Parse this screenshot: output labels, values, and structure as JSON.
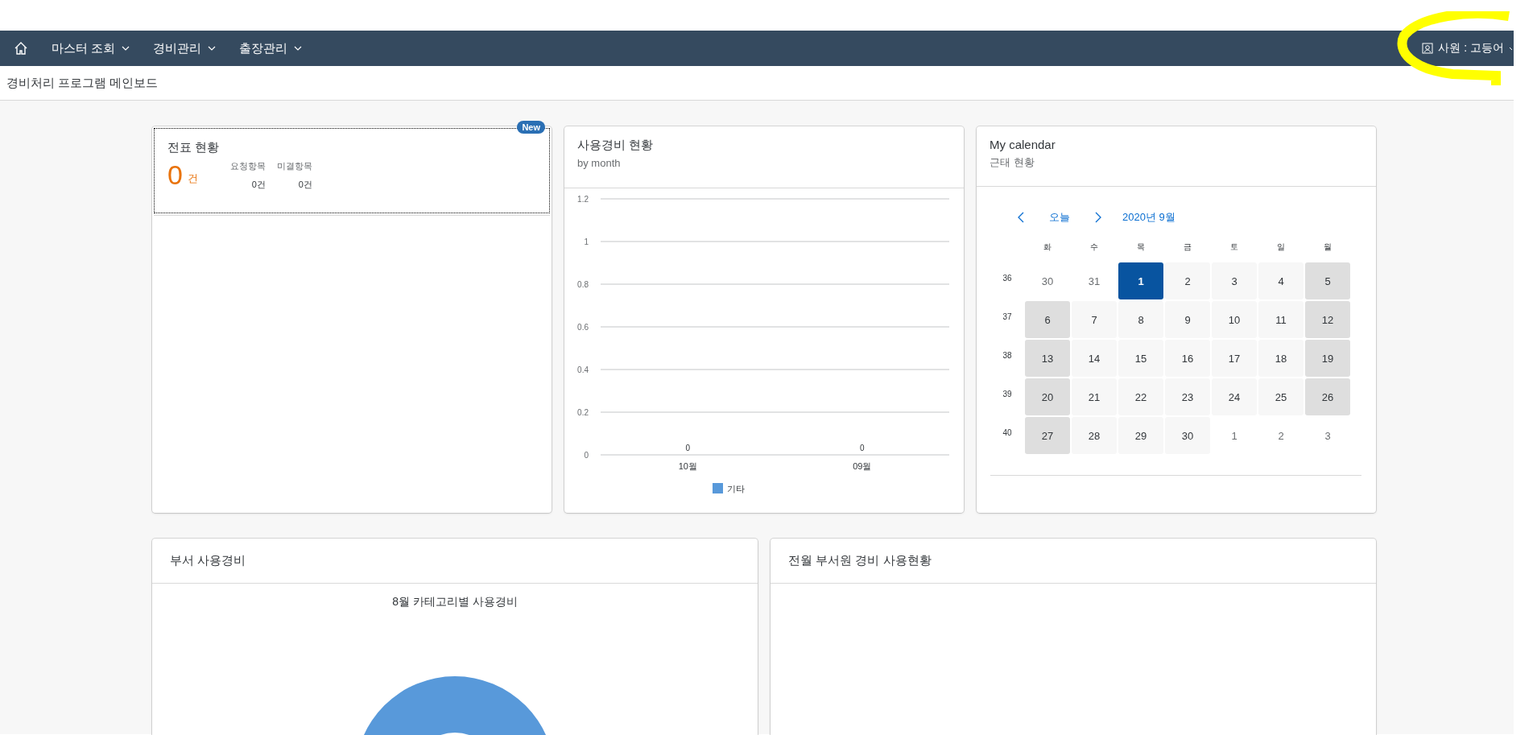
{
  "nav": {
    "items": [
      {
        "label": "마스터 조회"
      },
      {
        "label": "경비관리"
      },
      {
        "label": "출장관리"
      }
    ],
    "user": "사원 : 고등어"
  },
  "page_title": "경비처리 프로그램 메인보드",
  "voucher_card": {
    "title": "전표 현황",
    "badge": "New",
    "total": "0",
    "total_unit": "건",
    "stats": [
      {
        "label": "요청항목",
        "value": "0건"
      },
      {
        "label": "미결항목",
        "value": "0건"
      }
    ]
  },
  "expense_card": {
    "title": "사용경비 현황",
    "subtitle": "by month",
    "chart_data": {
      "type": "bar",
      "categories": [
        "10월",
        "09월"
      ],
      "series": [
        {
          "name": "기타",
          "color": "#5899da",
          "values": [
            0,
            0
          ]
        }
      ],
      "ylim": [
        0,
        1.2
      ],
      "yticks": [
        0,
        0.2,
        0.4,
        0.6,
        0.8,
        1,
        1.2
      ],
      "data_labels": true,
      "grid": true
    }
  },
  "calendar_card": {
    "title": "My calendar",
    "subtitle": "근태 현황",
    "today_button": "오늘",
    "month": "2020년 9월",
    "weekdays": [
      "화",
      "수",
      "목",
      "금",
      "토",
      "일",
      "월"
    ],
    "weeks": [
      {
        "number": "36",
        "days": [
          {
            "day": "30",
            "kind": "outside",
            "selected": false
          },
          {
            "day": "31",
            "kind": "outside",
            "selected": false
          },
          {
            "day": "1",
            "kind": "workday",
            "selected": true
          },
          {
            "day": "2",
            "kind": "workday",
            "selected": false
          },
          {
            "day": "3",
            "kind": "workday",
            "selected": false
          },
          {
            "day": "4",
            "kind": "workday",
            "selected": false
          },
          {
            "day": "5",
            "kind": "holiday",
            "selected": false
          }
        ]
      },
      {
        "number": "37",
        "days": [
          {
            "day": "6",
            "kind": "holiday",
            "selected": false
          },
          {
            "day": "7",
            "kind": "workday",
            "selected": false
          },
          {
            "day": "8",
            "kind": "workday",
            "selected": false
          },
          {
            "day": "9",
            "kind": "workday",
            "selected": false
          },
          {
            "day": "10",
            "kind": "workday",
            "selected": false
          },
          {
            "day": "11",
            "kind": "workday",
            "selected": false
          },
          {
            "day": "12",
            "kind": "holiday",
            "selected": false
          }
        ]
      },
      {
        "number": "38",
        "days": [
          {
            "day": "13",
            "kind": "holiday",
            "selected": false
          },
          {
            "day": "14",
            "kind": "workday",
            "selected": false
          },
          {
            "day": "15",
            "kind": "workday",
            "selected": false
          },
          {
            "day": "16",
            "kind": "workday",
            "selected": false
          },
          {
            "day": "17",
            "kind": "workday",
            "selected": false
          },
          {
            "day": "18",
            "kind": "workday",
            "selected": false
          },
          {
            "day": "19",
            "kind": "holiday",
            "selected": false
          }
        ]
      },
      {
        "number": "39",
        "days": [
          {
            "day": "20",
            "kind": "holiday",
            "selected": false
          },
          {
            "day": "21",
            "kind": "workday",
            "selected": false
          },
          {
            "day": "22",
            "kind": "workday",
            "selected": false
          },
          {
            "day": "23",
            "kind": "workday",
            "selected": false
          },
          {
            "day": "24",
            "kind": "workday",
            "selected": false
          },
          {
            "day": "25",
            "kind": "workday",
            "selected": false
          },
          {
            "day": "26",
            "kind": "holiday",
            "selected": false
          }
        ]
      },
      {
        "number": "40",
        "days": [
          {
            "day": "27",
            "kind": "holiday",
            "selected": false
          },
          {
            "day": "28",
            "kind": "workday",
            "selected": false
          },
          {
            "day": "29",
            "kind": "workday",
            "selected": false
          },
          {
            "day": "30",
            "kind": "workday",
            "selected": false
          },
          {
            "day": "1",
            "kind": "outside",
            "selected": false
          },
          {
            "day": "2",
            "kind": "outside",
            "selected": false
          },
          {
            "day": "3",
            "kind": "outside",
            "selected": false
          }
        ]
      }
    ]
  },
  "dept_card": {
    "title": "부서 사용경비",
    "chart_title": "8월 카테고리별 사용경비"
  },
  "members_card": {
    "title": "전월 부서원 경비 사용현황"
  }
}
